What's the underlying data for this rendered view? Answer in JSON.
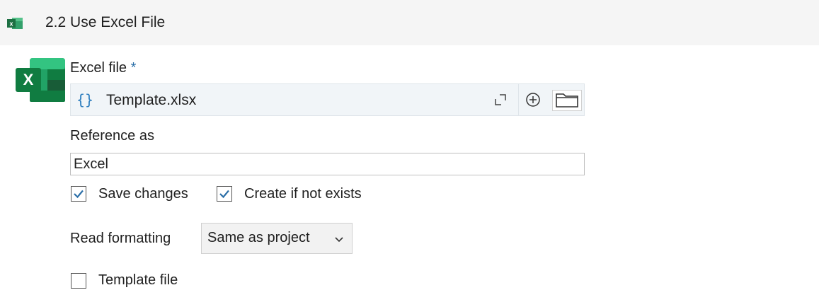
{
  "header": {
    "title": "2.2 Use Excel File",
    "icon": "excel-icon",
    "icon_color": "#1d6f42"
  },
  "excel_file": {
    "label": "Excel file",
    "required_mark": "*",
    "expression_icon": "{}",
    "value": "Template.xlsx"
  },
  "reference": {
    "label": "Reference as",
    "value": "Excel"
  },
  "save_changes": {
    "label": "Save changes",
    "checked": true
  },
  "create_if_not_exists": {
    "label": "Create if not exists",
    "checked": true
  },
  "read_formatting": {
    "label": "Read formatting",
    "selected": "Same as project"
  },
  "template_file": {
    "label": "Template file",
    "checked": false
  },
  "colors": {
    "accent": "#2b6fa8",
    "header_bg": "#f5f5f5",
    "excel_green": "#1d6f42"
  }
}
